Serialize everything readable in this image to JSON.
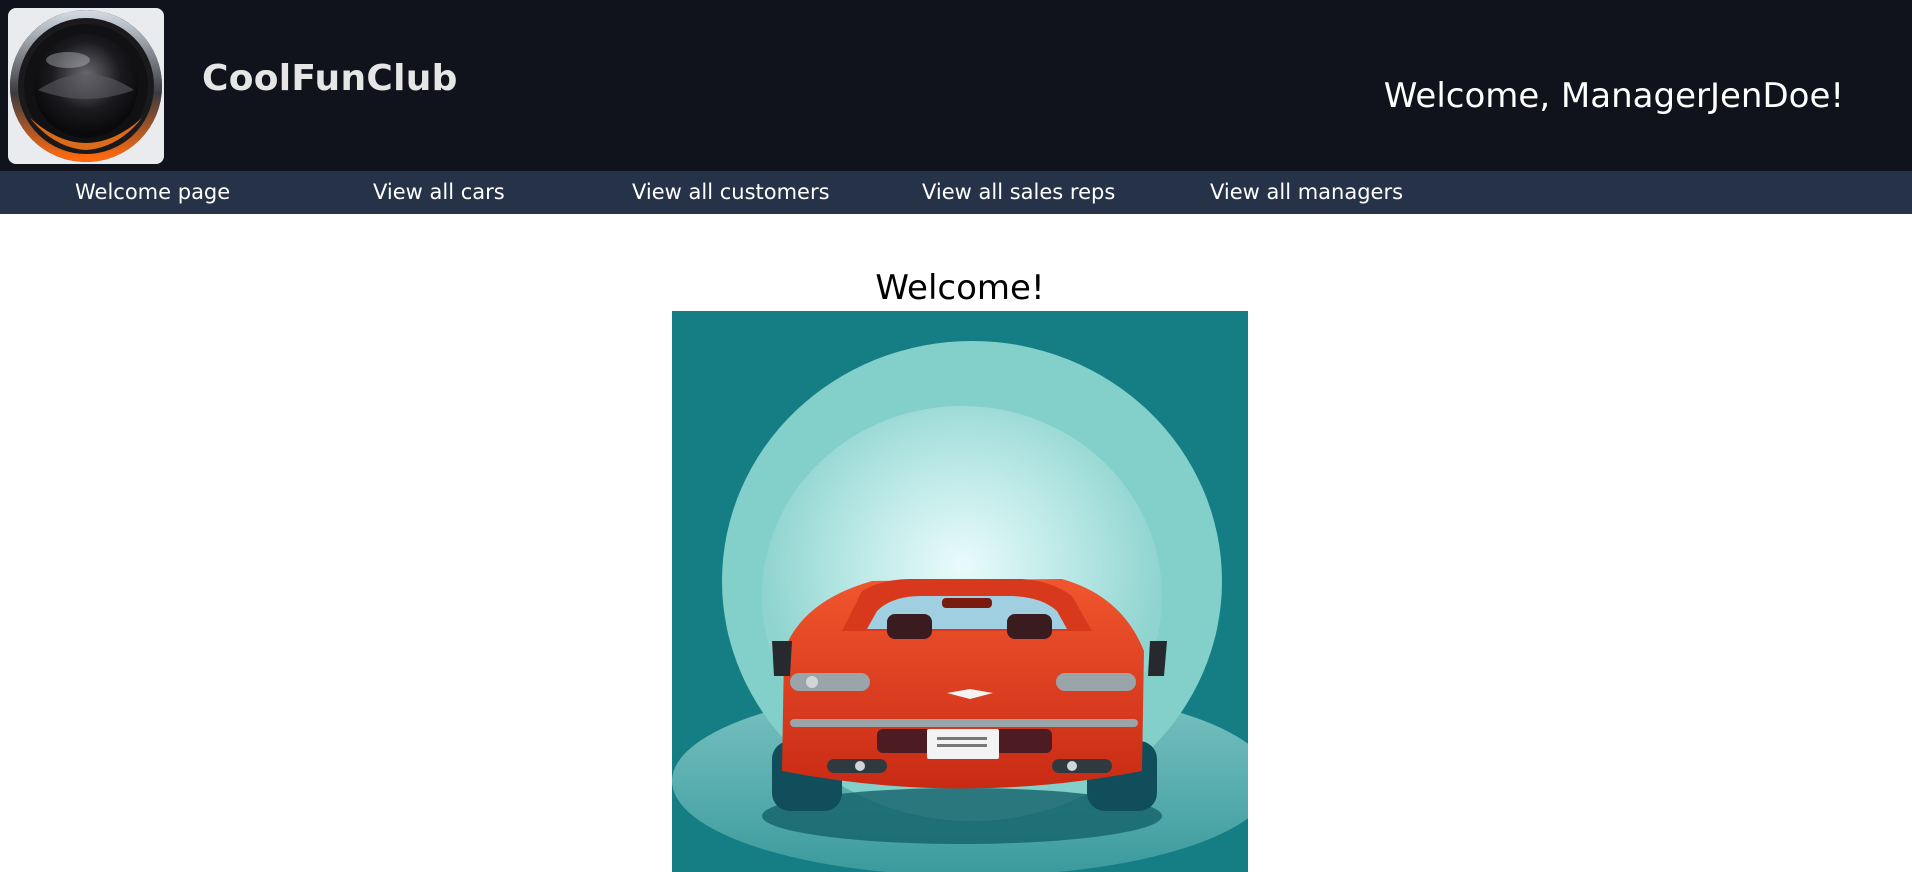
{
  "header": {
    "site_title": "CoolFunClub",
    "welcome_text": "Welcome, ManagerJenDoe!",
    "logo_icon": "wheel-logo-icon"
  },
  "nav": {
    "items": [
      {
        "label": "Welcome page"
      },
      {
        "label": "View all cars"
      },
      {
        "label": "View all customers"
      },
      {
        "label": "View all sales reps"
      },
      {
        "label": "View all managers"
      }
    ]
  },
  "main": {
    "heading": "Welcome!",
    "hero_image": "red-sports-car-illustration"
  },
  "colors": {
    "header_bg": "#10131b",
    "nav_bg": "#253248",
    "hero_bg": "#167f85",
    "car_red": "#e33a1f"
  }
}
